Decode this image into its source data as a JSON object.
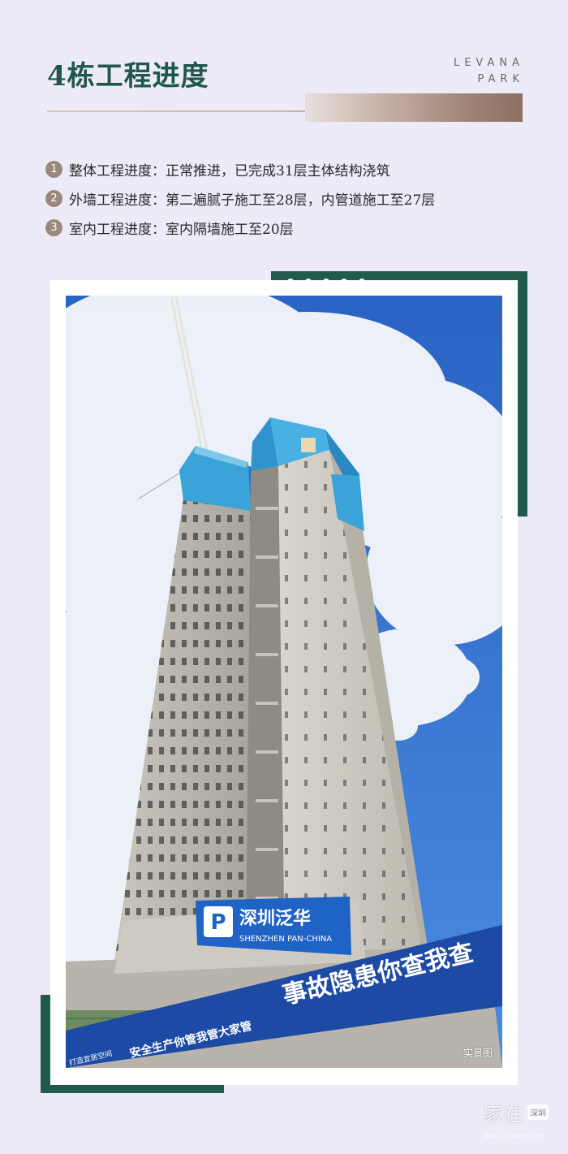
{
  "header": {
    "title": "4栋工程进度",
    "brand_line1": "LEVANA",
    "brand_line2": "PARK"
  },
  "progress": [
    {
      "num": "1",
      "text": "整体工程进度：正常推进，已完成31层主体结构浇筑"
    },
    {
      "num": "2",
      "text": "外墙工程进度：第二遍腻子施工至28层，内管道施工至27层"
    },
    {
      "num": "3",
      "text": "室内工程进度：室内隔墙施工至20层"
    }
  ],
  "photo": {
    "sign_cn": "深圳泛华",
    "sign_en": "SHENZHEN PAN-CHINA",
    "banner_main": "事故隐患你查我查",
    "banner_left": "安全生产你管我管大家管",
    "banner_small": "打造宜居空间",
    "caption": "实景图"
  },
  "watermark": {
    "main": "家在",
    "tag": "深圳",
    "sub": "bbs.szhome.com"
  },
  "colors": {
    "accent": "#215b4e",
    "badge": "#9a887c",
    "background": "#ecebf7"
  }
}
